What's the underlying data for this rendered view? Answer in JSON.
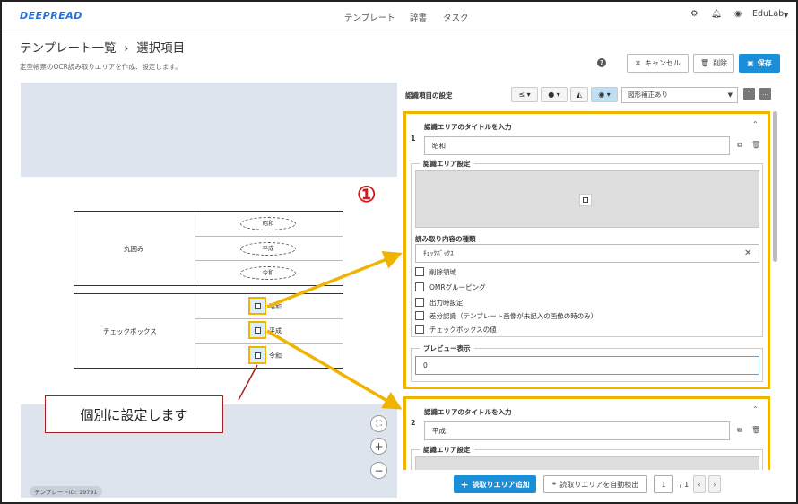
{
  "nav": {
    "logo": "DEEPREAD",
    "links": [
      "テンプレート",
      "辞書",
      "タスク"
    ],
    "user": "EduLab"
  },
  "header": {
    "title": "テンプレート一覧  ›  選択項目",
    "subtitle": "定型帳票のOCR読み取りエリアを作成、設定します。",
    "cancel_label": "キャンセル",
    "delete_label": "削除",
    "save_label": "保存"
  },
  "canvas": {
    "group1_label": "丸囲み",
    "group2_label": "チェックボックス",
    "ovals": [
      "昭和",
      "平成",
      "令和"
    ],
    "checkbox_texts": [
      "昭和",
      "平成",
      "令和"
    ],
    "callout": "個別に設定します",
    "template_id": "テンプレートID: 19791"
  },
  "right": {
    "toolbar_label": "認識項目の設定",
    "select_value": "図形補正あり",
    "card1": {
      "num": "1",
      "title_label": "認識エリアのタイトルを入力",
      "title_value": "昭和",
      "area_legend": "認識エリア設定",
      "type_label": "読み取り内容の種類",
      "type_value": "ﾁｪｯｸﾎﾞｯｸｽ",
      "options": [
        "削除領域",
        "OMRグルーピング",
        "出力時設定",
        "差分認識（テンプレート画像が未記入の画像の時のみ）",
        "チェックボックスの値"
      ],
      "preview_legend": "プレビュー表示",
      "preview_value": "0"
    },
    "card2": {
      "num": "2",
      "title_label": "認識エリアのタイトルを入力",
      "title_value": "平成",
      "area_legend": "認識エリア設定"
    },
    "add_button": "読取りエリア追加",
    "auto_detect_button": "読取りエリアを自動検出",
    "page_current": "1",
    "page_total": "/ 1"
  },
  "annotation": {
    "circled_number": "①"
  },
  "colors": {
    "accent": "#1a8fd8",
    "highlight": "#f0b400",
    "callout_border": "#a52020",
    "circled": "#d81818"
  }
}
